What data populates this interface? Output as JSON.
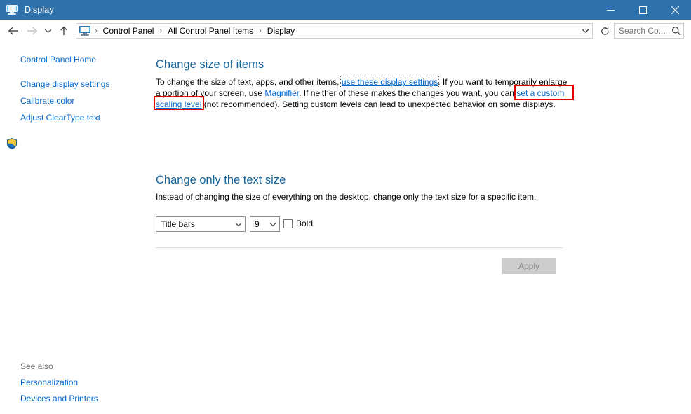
{
  "window": {
    "title": "Display",
    "title_icon": "display-monitor-icon",
    "controls": {
      "minimize": "minimize-icon",
      "maximize": "maximize-icon",
      "close": "close-icon"
    }
  },
  "navbar": {
    "back_icon": "back-arrow-icon",
    "forward_icon": "forward-arrow-icon",
    "recent_icon": "chevron-down-icon",
    "up_icon": "up-arrow-icon",
    "address_icon": "display-monitor-icon",
    "breadcrumbs": [
      "Control Panel",
      "All Control Panel Items",
      "Display"
    ],
    "separator": "›",
    "dropdown_icon": "chevron-down-icon",
    "refresh_icon": "refresh-icon",
    "search": {
      "value": "",
      "placeholder": "Search Co...",
      "icon": "search-icon"
    }
  },
  "help": {
    "icon": "help-question-icon",
    "label": "?"
  },
  "sidebar": {
    "items": [
      {
        "label": "Control Panel Home",
        "icon": null
      },
      {
        "label": "Change display settings",
        "icon": null
      },
      {
        "label": "Calibrate color",
        "icon": "uac-shield-icon"
      },
      {
        "label": "Adjust ClearType text",
        "icon": null
      }
    ],
    "see_also": {
      "heading": "See also",
      "items": [
        "Personalization",
        "Devices and Printers"
      ]
    }
  },
  "main": {
    "section1": {
      "heading": "Change size of items",
      "line1_a": "To change the size of text, apps, and other items, ",
      "line1_link": "use these display settings",
      "line1_b": ".  If you want to temporarily enlarge",
      "line2_a": "a portion of your screen, use ",
      "line2_link": "Magnifier",
      "line2_b": ".  If neither of these makes the changes you want, you can ",
      "line2_link2": "set a custom",
      "line3_link": "scaling level",
      "line3_b": " (not recommended).  Setting custom levels can lead to unexpected behavior on some displays."
    },
    "section2": {
      "heading": "Change only the text size",
      "description": "Instead of changing the size of everything on the desktop, change only the text size for a specific item.",
      "item_combo": {
        "value": "Title bars",
        "arrow_icon": "chevron-down-icon"
      },
      "size_combo": {
        "value": "9",
        "arrow_icon": "chevron-down-icon"
      },
      "bold_checkbox": {
        "label": "Bold",
        "checked": false
      },
      "apply_button": {
        "label": "Apply",
        "enabled": false
      }
    }
  },
  "annotations": {
    "highlight_color": "#e60000",
    "boxes": [
      {
        "target": "set a custom"
      },
      {
        "target": "scaling level"
      }
    ]
  },
  "colors": {
    "titlebar": "#2f72ab",
    "heading_blue": "#12649b",
    "link_blue": "#0066cc",
    "annotation_red": "#e60000"
  }
}
